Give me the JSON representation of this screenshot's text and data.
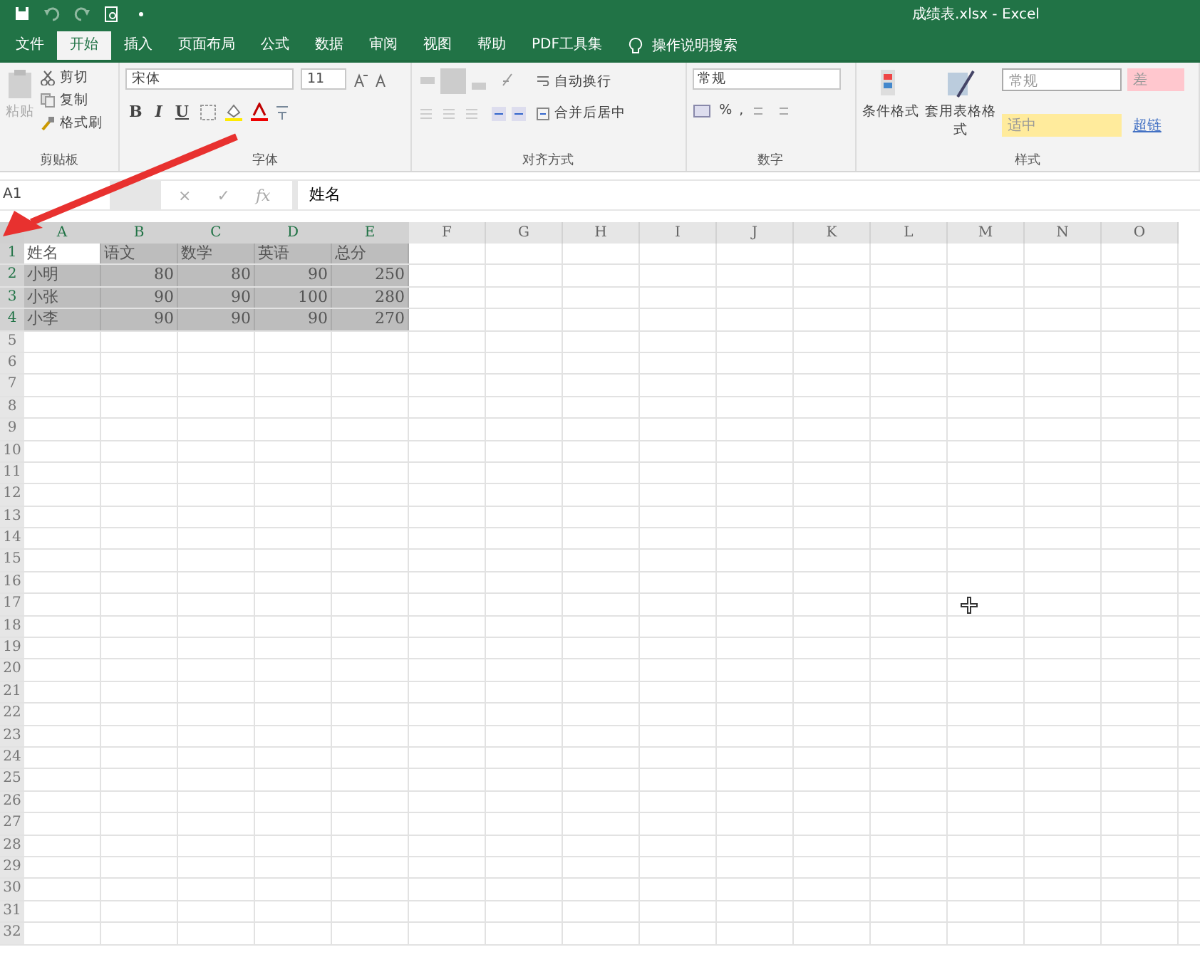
{
  "window": {
    "title": "成绩表.xlsx  -  Excel"
  },
  "tabs": [
    {
      "label": "文件",
      "selected": false
    },
    {
      "label": "开始",
      "selected": true
    },
    {
      "label": "插入",
      "selected": false
    },
    {
      "label": "页面布局",
      "selected": false
    },
    {
      "label": "公式",
      "selected": false
    },
    {
      "label": "数据",
      "selected": false
    },
    {
      "label": "审阅",
      "selected": false
    },
    {
      "label": "视图",
      "selected": false
    },
    {
      "label": "帮助",
      "selected": false
    },
    {
      "label": "PDF工具集",
      "selected": false
    }
  ],
  "tell_me": "操作说明搜索",
  "ribbon": {
    "clipboard": {
      "paste": "粘贴",
      "cut": "剪切",
      "copy": "复制",
      "format_painter": "格式刷",
      "label": "剪贴板"
    },
    "font": {
      "font_name": "宋体",
      "font_size": "11",
      "bold": "B",
      "italic": "I",
      "underline": "U",
      "label": "字体"
    },
    "alignment": {
      "wrap": "自动换行",
      "merge": "合并后居中",
      "label": "对齐方式"
    },
    "number": {
      "format": "常规",
      "percent": "%",
      "comma": ",",
      "label": "数字"
    },
    "styles": {
      "conditional": "条件格式",
      "format_table": "套用表格格式",
      "cell_styles": [
        {
          "label": "常规",
          "color": "#ffffff"
        },
        {
          "label": "差",
          "color": "#ffc7ce"
        },
        {
          "label": "适中",
          "color": "#ffeb9c"
        },
        {
          "label": "超链",
          "color": "#f3f3f3"
        }
      ],
      "label": "样式"
    }
  },
  "formula_bar": {
    "name_box": "A1",
    "cancel": "×",
    "enter": "✓",
    "function": "fx",
    "value": "姓名"
  },
  "sheet": {
    "columns": [
      {
        "label": "A",
        "selected": true
      },
      {
        "label": "B",
        "selected": true
      },
      {
        "label": "C",
        "selected": true
      },
      {
        "label": "D",
        "selected": true
      },
      {
        "label": "E",
        "selected": true
      },
      {
        "label": "F",
        "selected": false
      },
      {
        "label": "G",
        "selected": false
      },
      {
        "label": "H",
        "selected": false
      },
      {
        "label": "I",
        "selected": false
      },
      {
        "label": "J",
        "selected": false
      },
      {
        "label": "K",
        "selected": false
      },
      {
        "label": "L",
        "selected": false
      },
      {
        "label": "M",
        "selected": false
      },
      {
        "label": "N",
        "selected": false
      },
      {
        "label": "O",
        "selected": false
      }
    ],
    "rows": [
      {
        "header": "1",
        "selected": true,
        "cells": [
          {
            "text": "姓名",
            "kind": "text",
            "active": true
          },
          {
            "text": "语文",
            "kind": "text",
            "active": false
          },
          {
            "text": "数学",
            "kind": "text",
            "active": false
          },
          {
            "text": "英语",
            "kind": "text",
            "active": false
          },
          {
            "text": "总分",
            "kind": "text",
            "active": false
          }
        ]
      },
      {
        "header": "2",
        "selected": true,
        "cells": [
          {
            "text": "小明",
            "kind": "text",
            "active": false
          },
          {
            "text": "80",
            "kind": "number",
            "active": false
          },
          {
            "text": "80",
            "kind": "number",
            "active": false
          },
          {
            "text": "90",
            "kind": "number",
            "active": false
          },
          {
            "text": "250",
            "kind": "number",
            "active": false
          }
        ]
      },
      {
        "header": "3",
        "selected": true,
        "cells": [
          {
            "text": "小张",
            "kind": "text",
            "active": false
          },
          {
            "text": "90",
            "kind": "number",
            "active": false
          },
          {
            "text": "90",
            "kind": "number",
            "active": false
          },
          {
            "text": "100",
            "kind": "number",
            "active": false
          },
          {
            "text": "280",
            "kind": "number",
            "active": false
          }
        ]
      },
      {
        "header": "4",
        "selected": true,
        "cells": [
          {
            "text": "小李",
            "kind": "text",
            "active": false
          },
          {
            "text": "90",
            "kind": "number",
            "active": false
          },
          {
            "text": "90",
            "kind": "number",
            "active": false
          },
          {
            "text": "90",
            "kind": "number",
            "active": false
          },
          {
            "text": "270",
            "kind": "number",
            "active": false
          }
        ]
      },
      {
        "header": "5",
        "selected": false,
        "cells": []
      },
      {
        "header": "6",
        "selected": false,
        "cells": []
      },
      {
        "header": "7",
        "selected": false,
        "cells": []
      },
      {
        "header": "8",
        "selected": false,
        "cells": []
      },
      {
        "header": "9",
        "selected": false,
        "cells": []
      },
      {
        "header": "10",
        "selected": false,
        "cells": []
      },
      {
        "header": "11",
        "selected": false,
        "cells": []
      },
      {
        "header": "12",
        "selected": false,
        "cells": []
      },
      {
        "header": "13",
        "selected": false,
        "cells": []
      },
      {
        "header": "14",
        "selected": false,
        "cells": []
      },
      {
        "header": "15",
        "selected": false,
        "cells": []
      },
      {
        "header": "16",
        "selected": false,
        "cells": []
      },
      {
        "header": "17",
        "selected": false,
        "cells": []
      },
      {
        "header": "18",
        "selected": false,
        "cells": []
      },
      {
        "header": "19",
        "selected": false,
        "cells": []
      },
      {
        "header": "20",
        "selected": false,
        "cells": []
      },
      {
        "header": "21",
        "selected": false,
        "cells": []
      },
      {
        "header": "22",
        "selected": false,
        "cells": []
      },
      {
        "header": "23",
        "selected": false,
        "cells": []
      },
      {
        "header": "24",
        "selected": false,
        "cells": []
      },
      {
        "header": "25",
        "selected": false,
        "cells": []
      },
      {
        "header": "26",
        "selected": false,
        "cells": []
      },
      {
        "header": "27",
        "selected": false,
        "cells": []
      },
      {
        "header": "28",
        "selected": false,
        "cells": []
      },
      {
        "header": "29",
        "selected": false,
        "cells": []
      },
      {
        "header": "30",
        "selected": false,
        "cells": []
      },
      {
        "header": "31",
        "selected": false,
        "cells": []
      },
      {
        "header": "32",
        "selected": false,
        "cells": []
      }
    ]
  }
}
